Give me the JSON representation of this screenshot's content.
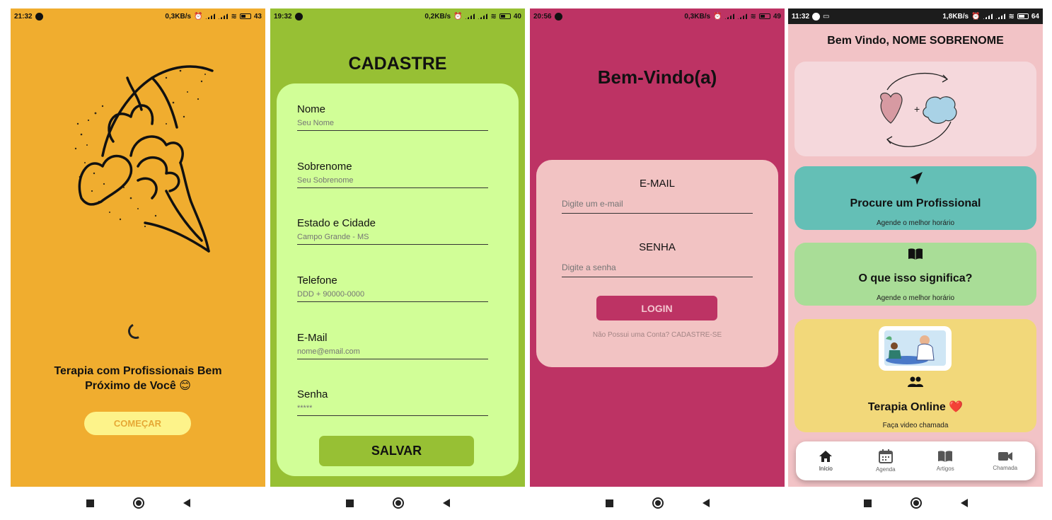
{
  "screens": {
    "splash": {
      "status": {
        "time": "21:32",
        "speed": "0,3KB/s",
        "battery": "43"
      },
      "tagline_line1": "Terapia com Profissionais Bem",
      "tagline_line2": "Próximo de Você 😊",
      "start_label": "COMEÇAR",
      "colors": {
        "background": "#f0ad2f",
        "button": "#fdf38a"
      }
    },
    "register": {
      "status": {
        "time": "19:32",
        "speed": "0,2KB/s",
        "battery": "40"
      },
      "title": "CADASTRE",
      "fields": [
        {
          "label": "Nome",
          "placeholder": "Seu Nome"
        },
        {
          "label": "Sobrenome",
          "placeholder": "Seu Sobrenome"
        },
        {
          "label": "Estado e Cidade",
          "placeholder": "Campo Grande - MS"
        },
        {
          "label": "Telefone",
          "placeholder": "DDD + 90000-0000"
        },
        {
          "label": "E-Mail",
          "placeholder": "nome@email.com"
        },
        {
          "label": "Senha",
          "placeholder": "*****"
        }
      ],
      "save_label": "SALVAR",
      "colors": {
        "background": "#97c034",
        "card": "#d1fe97"
      }
    },
    "login": {
      "status": {
        "time": "20:56",
        "speed": "0,3KB/s",
        "battery": "49"
      },
      "title": "Bem-Vindo(a)",
      "email_label": "E-MAIL",
      "email_placeholder": "Digite um e-mail",
      "password_label": "SENHA",
      "password_placeholder": "Digite a senha",
      "login_label": "LOGIN",
      "signup_text": "Não Possui uma Conta? CADASTRE-SE",
      "colors": {
        "background": "#bd3364",
        "card": "#f2c3c3"
      }
    },
    "home": {
      "status": {
        "time": "11:32",
        "speed": "1,8KB/s",
        "battery": "64"
      },
      "greeting": "Bem Vindo, NOME SOBRENOME",
      "tiles": [
        {
          "icon": "navigation-arrow-icon",
          "title": "Procure um Profissional",
          "subtitle": "Agende o melhor horário",
          "color": "#64bfb6"
        },
        {
          "icon": "open-book-icon",
          "title": "O que isso significa?",
          "subtitle": "Agende o melhor horário",
          "color": "#a9dd97"
        },
        {
          "icon": "people-icon",
          "title": "Terapia Online ❤️",
          "subtitle": "Faça video chamada",
          "color": "#f2d87a"
        }
      ],
      "tabs": [
        {
          "icon": "home-icon",
          "label": "Início"
        },
        {
          "icon": "calendar-icon",
          "label": "Agenda"
        },
        {
          "icon": "book-icon",
          "label": "Artigos"
        },
        {
          "icon": "video-camera-icon",
          "label": "Chamada"
        }
      ],
      "colors": {
        "background": "#f2c3c6",
        "hero_card": "#f5d8dc"
      }
    }
  }
}
